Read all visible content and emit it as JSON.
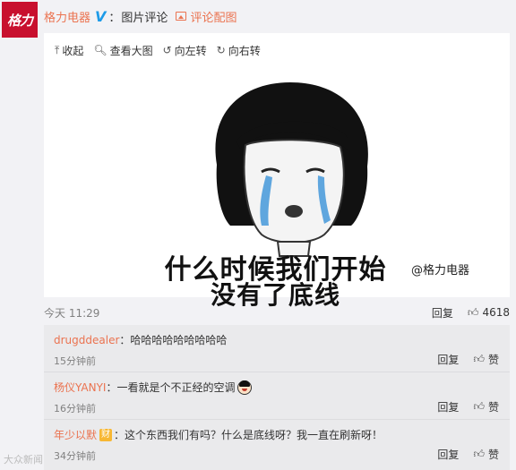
{
  "post": {
    "avatar_text": "格力",
    "author": "格力电器",
    "verified_badge": "V",
    "colon": "：",
    "subject": "图片评论",
    "tag": "评论配图"
  },
  "toolbar": {
    "collapse": "收起",
    "view_large": "查看大图",
    "rotate_left": "向左转",
    "rotate_right": "向右转"
  },
  "meme": {
    "line1": "什么时候我们开始",
    "line2": "没有了底线",
    "watermark": "@格力电器"
  },
  "meta": {
    "time": "今天 11:29",
    "reply": "回复",
    "likes": "4618"
  },
  "comments": [
    {
      "user": "drugddealer",
      "sep": "：",
      "text": "哈哈哈哈哈哈哈哈哈",
      "time": "15分钟前",
      "reply": "回复",
      "like": "赞"
    },
    {
      "user": "杨仪YANYI",
      "sep": "：",
      "text": "一看就是个不正经的空调",
      "time": "16分钟前",
      "reply": "回复",
      "like": "赞"
    },
    {
      "user": "年少以默",
      "badge": "财",
      "sep": "：",
      "text": "这个东西我们有吗？什么是底线呀？我一直在刷新呀！",
      "time": "34分钟前",
      "reply": "回复",
      "like": "赞"
    }
  ],
  "site_watermark": "大众新闻",
  "colors": {
    "accent": "#eb7350",
    "verified": "#1d9be8",
    "brand": "#c8102e"
  },
  "icons": [
    "collapse-icon",
    "zoom-icon",
    "rotate-left-icon",
    "rotate-right-icon",
    "thumbs-up-icon",
    "picture-icon"
  ]
}
